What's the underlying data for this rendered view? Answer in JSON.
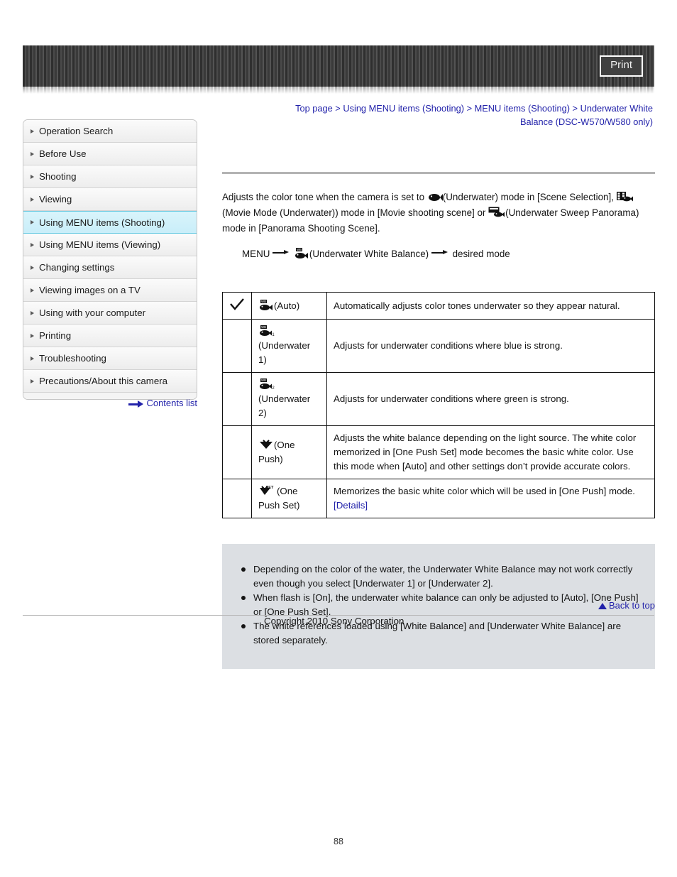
{
  "header": {
    "print_label": "Print"
  },
  "breadcrumb": {
    "items": [
      "Top page",
      "Using MENU items (Shooting)",
      "MENU items (Shooting)",
      "Underwater White Balance (DSC-W570/W580 only)"
    ],
    "separator": ">",
    "line1": "Top page > Using MENU items (Shooting) > MENU items (Shooting) > Underwater White",
    "line2": "Balance (DSC-W570/W580 only)"
  },
  "sidebar": {
    "items": [
      {
        "label": "Operation Search",
        "active": false
      },
      {
        "label": "Before Use",
        "active": false
      },
      {
        "label": "Shooting",
        "active": false
      },
      {
        "label": "Viewing",
        "active": false
      },
      {
        "label": "Using MENU items (Shooting)",
        "active": true
      },
      {
        "label": "Using MENU items (Viewing)",
        "active": false
      },
      {
        "label": "Changing settings",
        "active": false
      },
      {
        "label": "Viewing images on a TV",
        "active": false
      },
      {
        "label": "Using with your computer",
        "active": false
      },
      {
        "label": "Printing",
        "active": false
      },
      {
        "label": "Troubleshooting",
        "active": false
      },
      {
        "label": "Precautions/About this camera",
        "active": false
      }
    ],
    "contents_link": "Contents list"
  },
  "main": {
    "intro": {
      "p1_a": "Adjusts the color tone when the camera is set to ",
      "p1_b": "(Underwater) mode in [Scene Selection], ",
      "p1_c": "(Movie Mode (Underwater)) mode in [Movie shooting scene] or ",
      "p1_d": "(Underwater Sweep Panorama) mode in [Panorama Shooting Scene]."
    },
    "menu_path": {
      "menu_label": "MENU",
      "item_label": "(Underwater White Balance)",
      "result_label": "desired mode"
    },
    "table": {
      "rows": [
        {
          "checked": true,
          "icon": "wb-fish-auto-icon",
          "mode": "(Auto)",
          "desc": "Automatically adjusts color tones underwater so they appear natural."
        },
        {
          "checked": false,
          "icon": "wb-fish-1-icon",
          "mode": "(Underwater 1)",
          "desc": "Adjusts for underwater conditions where blue is strong."
        },
        {
          "checked": false,
          "icon": "wb-fish-2-icon",
          "mode": "(Underwater 2)",
          "desc": "Adjusts for underwater conditions where green is strong."
        },
        {
          "checked": false,
          "icon": "one-push-icon",
          "mode": "(One Push)",
          "desc": "Adjusts the white balance depending on the light source. The white color memorized in [One Push Set] mode becomes the basic white color. Use this mode when [Auto] and other settings don’t provide accurate colors."
        },
        {
          "checked": false,
          "icon": "one-push-set-icon",
          "mode": "(One Push Set)",
          "desc": "Memorizes the basic white color which will be used in [One Push] mode.",
          "link": "[Details]"
        }
      ]
    },
    "notes": [
      "Depending on the color of the water, the Underwater White Balance may not work correctly even though you select [Underwater 1] or [Underwater 2].",
      "When flash is [On], the underwater white balance can only be adjusted to [Auto], [One Push] or [One Push Set].",
      "The white references loaded using [White Balance] and [Underwater White Balance] are stored separately."
    ]
  },
  "footer": {
    "back_to_top": "Back to top",
    "copyright": "Copyright 2010 Sony Corporation",
    "page_number": "88"
  },
  "colors": {
    "link": "#2222aa",
    "active_sidebar": "#c9eef9",
    "notes_bg": "#dcdfe3",
    "rule": "#b3b3b3"
  }
}
